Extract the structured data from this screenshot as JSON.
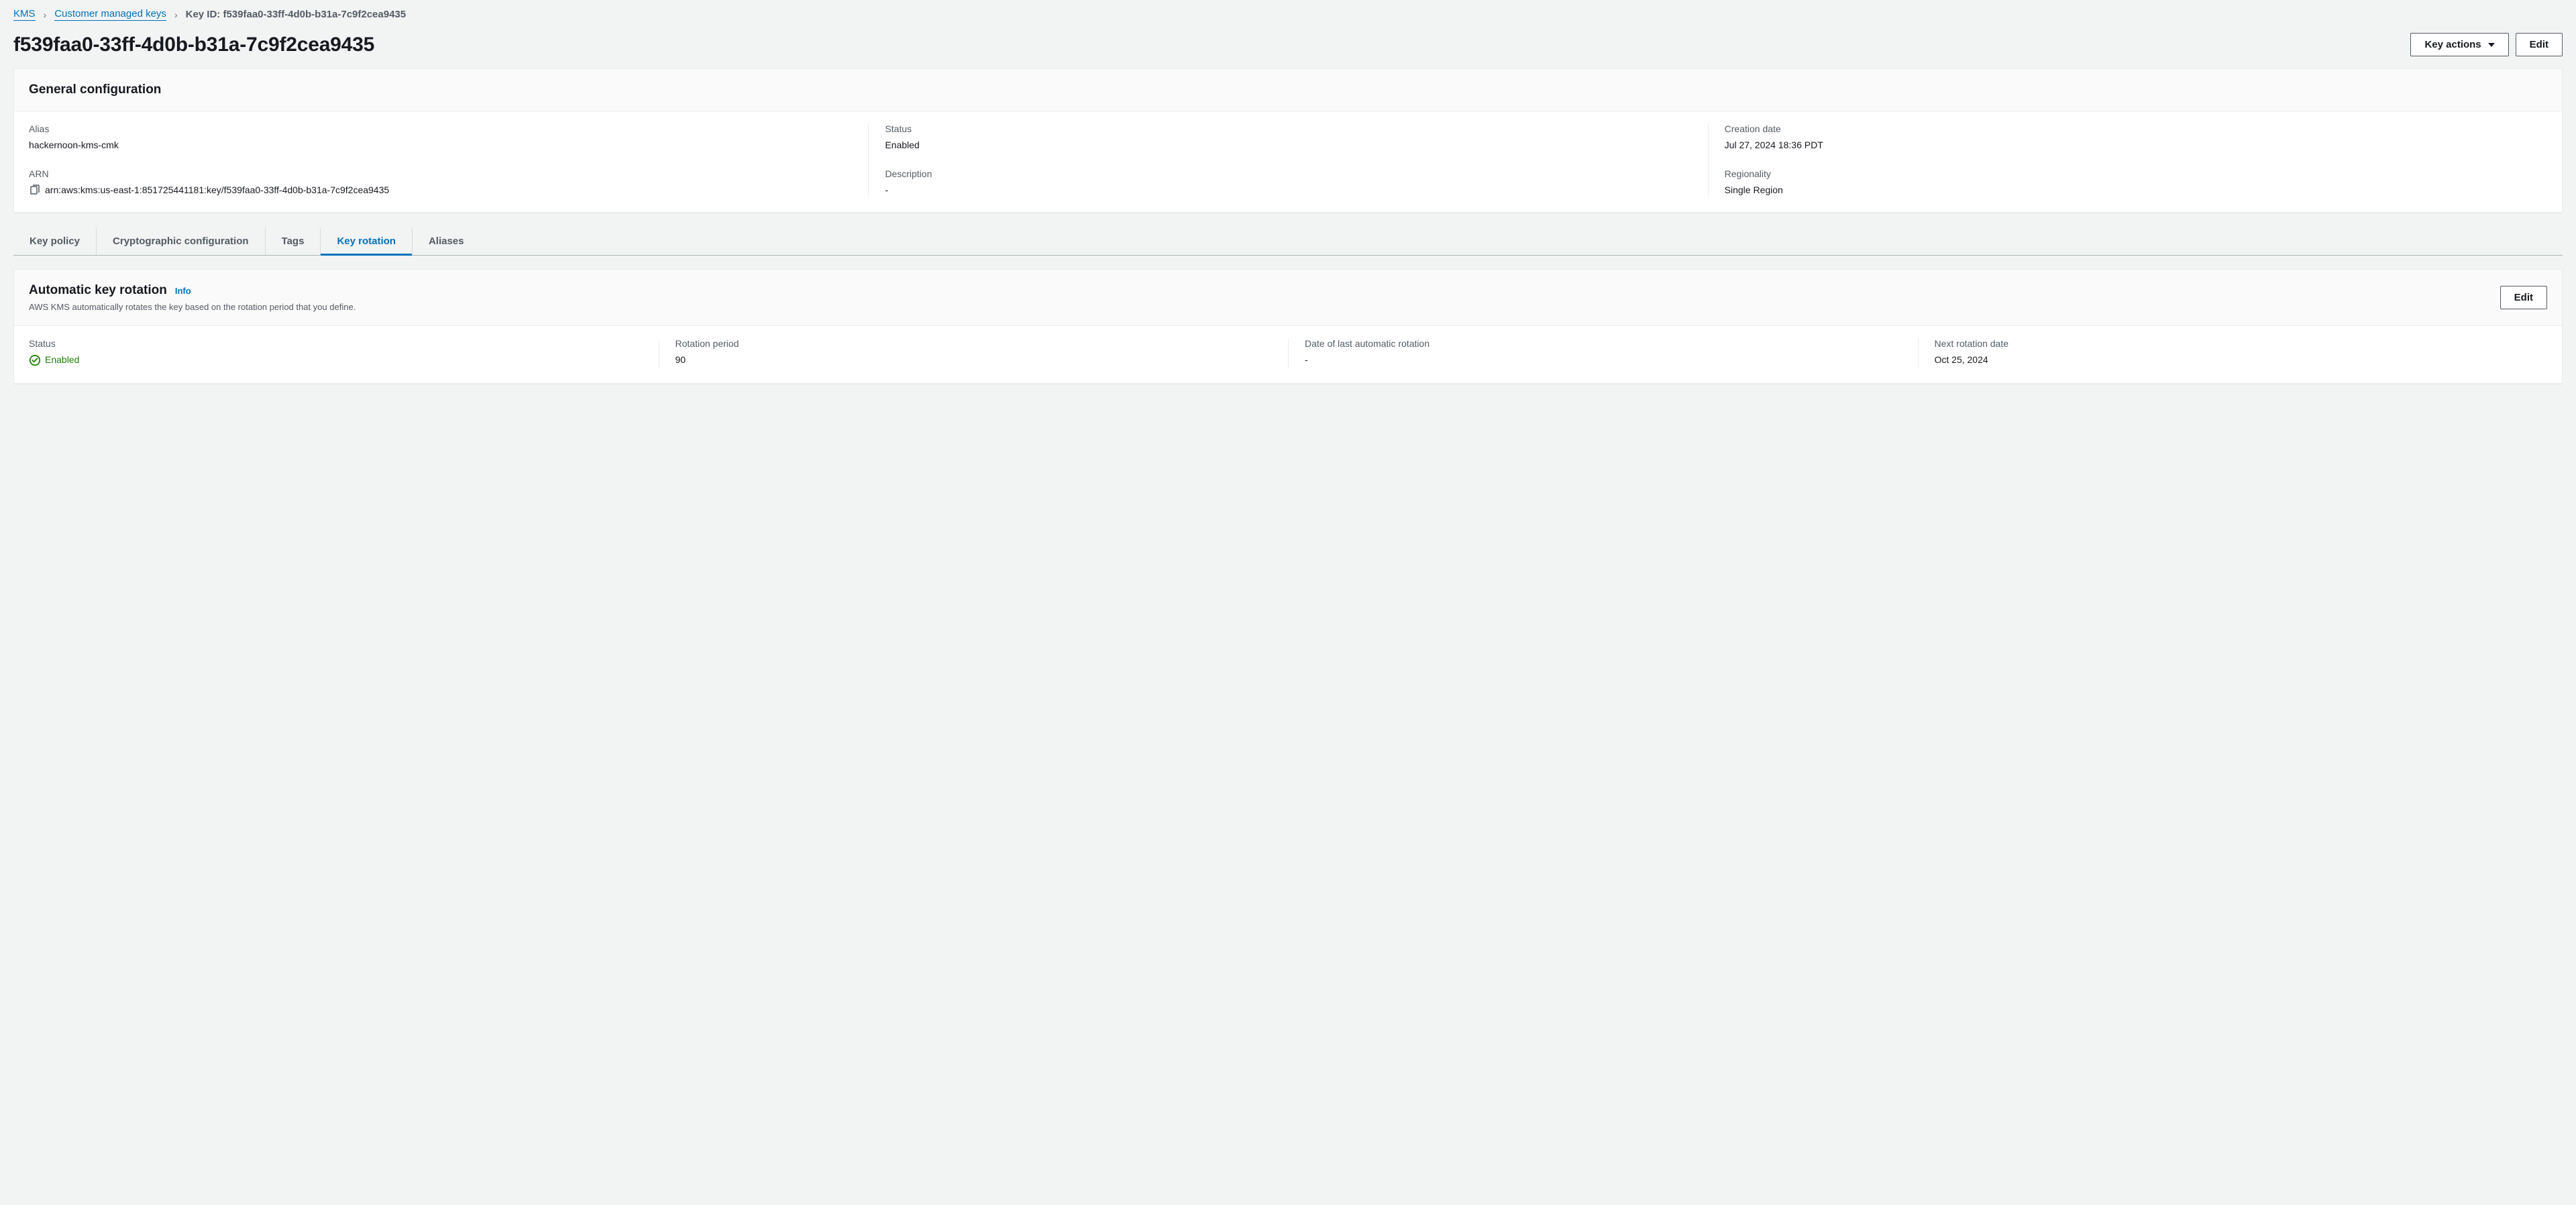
{
  "breadcrumb": {
    "root": "KMS",
    "parent": "Customer managed keys",
    "current": "Key ID: f539faa0-33ff-4d0b-b31a-7c9f2cea9435"
  },
  "header": {
    "title": "f539faa0-33ff-4d0b-b31a-7c9f2cea9435",
    "key_actions": "Key actions",
    "edit": "Edit"
  },
  "general_config": {
    "panel_title": "General configuration",
    "alias_label": "Alias",
    "alias_value": "hackernoon-kms-cmk",
    "arn_label": "ARN",
    "arn_value": "arn:aws:kms:us-east-1:851725441181:key/f539faa0-33ff-4d0b-b31a-7c9f2cea9435",
    "status_label": "Status",
    "status_value": "Enabled",
    "description_label": "Description",
    "description_value": "-",
    "creation_label": "Creation date",
    "creation_value": "Jul 27, 2024 18:36 PDT",
    "regionality_label": "Regionality",
    "regionality_value": "Single Region"
  },
  "tabs": {
    "key_policy": "Key policy",
    "crypto_config": "Cryptographic configuration",
    "tags": "Tags",
    "key_rotation": "Key rotation",
    "aliases": "Aliases"
  },
  "rotation": {
    "panel_title": "Automatic key rotation",
    "info": "Info",
    "subtitle": "AWS KMS automatically rotates the key based on the rotation period that you define.",
    "edit": "Edit",
    "status_label": "Status",
    "status_value": "Enabled",
    "period_label": "Rotation period",
    "period_value": "90",
    "last_label": "Date of last automatic rotation",
    "last_value": "-",
    "next_label": "Next rotation date",
    "next_value": "Oct 25, 2024"
  }
}
